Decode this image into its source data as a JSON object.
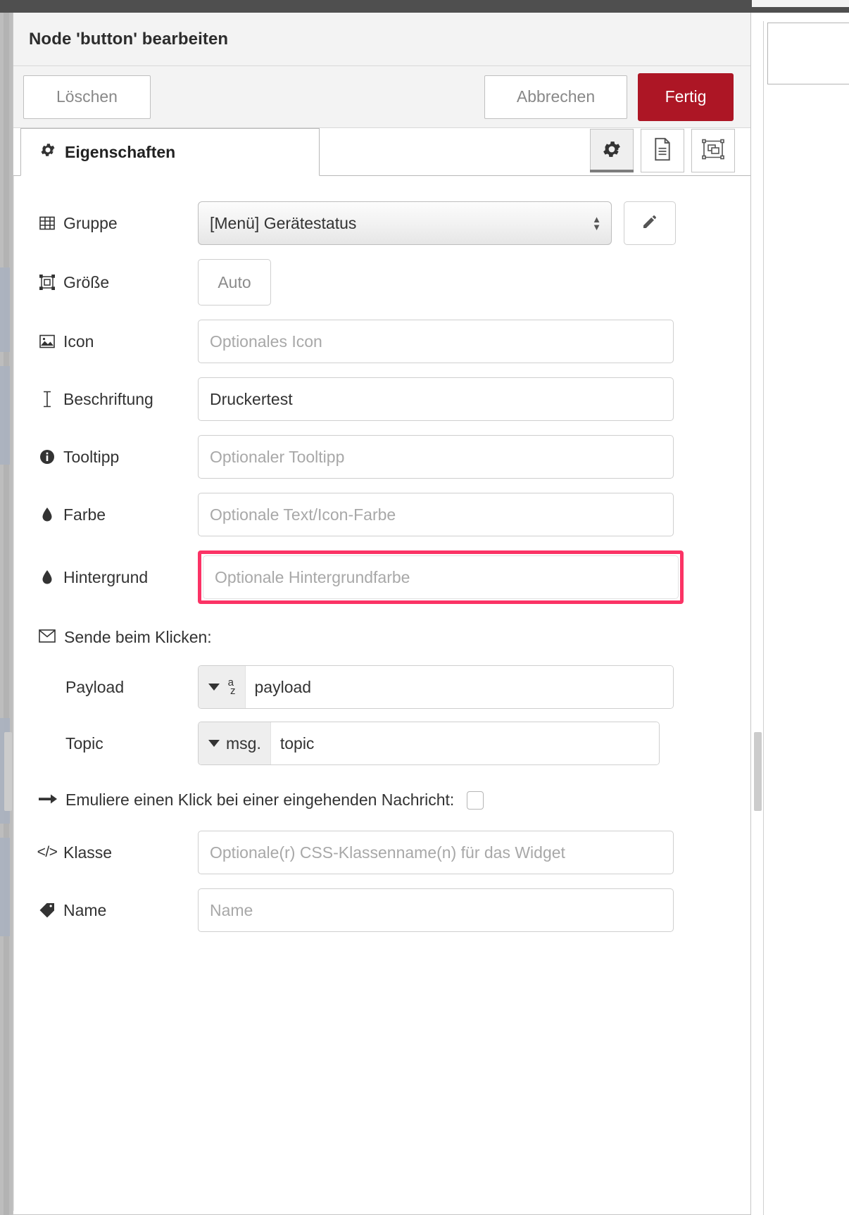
{
  "dialog": {
    "title": "Node 'button' bearbeiten",
    "buttons": {
      "delete": "Löschen",
      "cancel": "Abbrechen",
      "done": "Fertig"
    },
    "accent_done_color": "#ad1625",
    "highlight_color": "#fb3365"
  },
  "tabs": {
    "active_label": "Eigenschaften",
    "tools": [
      {
        "name": "properties",
        "icon": "gear-icon",
        "active": true
      },
      {
        "name": "description",
        "icon": "document-icon",
        "active": false
      },
      {
        "name": "appearance",
        "icon": "appearance-icon",
        "active": false
      }
    ]
  },
  "form": {
    "group": {
      "label": "Gruppe",
      "icon": "table-icon",
      "value": "[Menü] Gerätestatus",
      "edit_button_icon": "pencil-icon"
    },
    "size": {
      "label": "Größe",
      "icon": "resize-icon",
      "value": "Auto"
    },
    "icon_field": {
      "label": "Icon",
      "icon": "image-icon",
      "value": "",
      "placeholder": "Optionales Icon"
    },
    "label_field": {
      "label": "Beschriftung",
      "icon": "text-cursor-icon",
      "value": "Druckertest",
      "placeholder": ""
    },
    "tooltip": {
      "label": "Tooltipp",
      "icon": "info-icon",
      "value": "",
      "placeholder": "Optionaler Tooltipp"
    },
    "color": {
      "label": "Farbe",
      "icon": "droplet-icon",
      "value": "",
      "placeholder": "Optionale Text/Icon-Farbe"
    },
    "background": {
      "label": "Hintergrund",
      "icon": "droplet-icon",
      "value": "",
      "placeholder": "Optionale Hintergrundfarbe",
      "highlighted": true
    },
    "send_section": {
      "heading": "Sende beim Klicken:",
      "icon": "envelope-icon",
      "payload": {
        "label": "Payload",
        "type_label": "az",
        "value": "payload"
      },
      "topic": {
        "label": "Topic",
        "type_label": "msg.",
        "value": "topic"
      }
    },
    "emulate": {
      "label": "Emuliere einen Klick bei einer eingehenden Nachricht:",
      "icon": "arrow-right-icon",
      "checked": false
    },
    "css_class": {
      "label": "Klasse",
      "icon": "code-icon",
      "icon_text": "</>",
      "value": "",
      "placeholder": "Optionale(r) CSS-Klassenname(n) für das Widget"
    },
    "name": {
      "label": "Name",
      "icon": "tag-icon",
      "value": "",
      "placeholder": "Name"
    }
  }
}
